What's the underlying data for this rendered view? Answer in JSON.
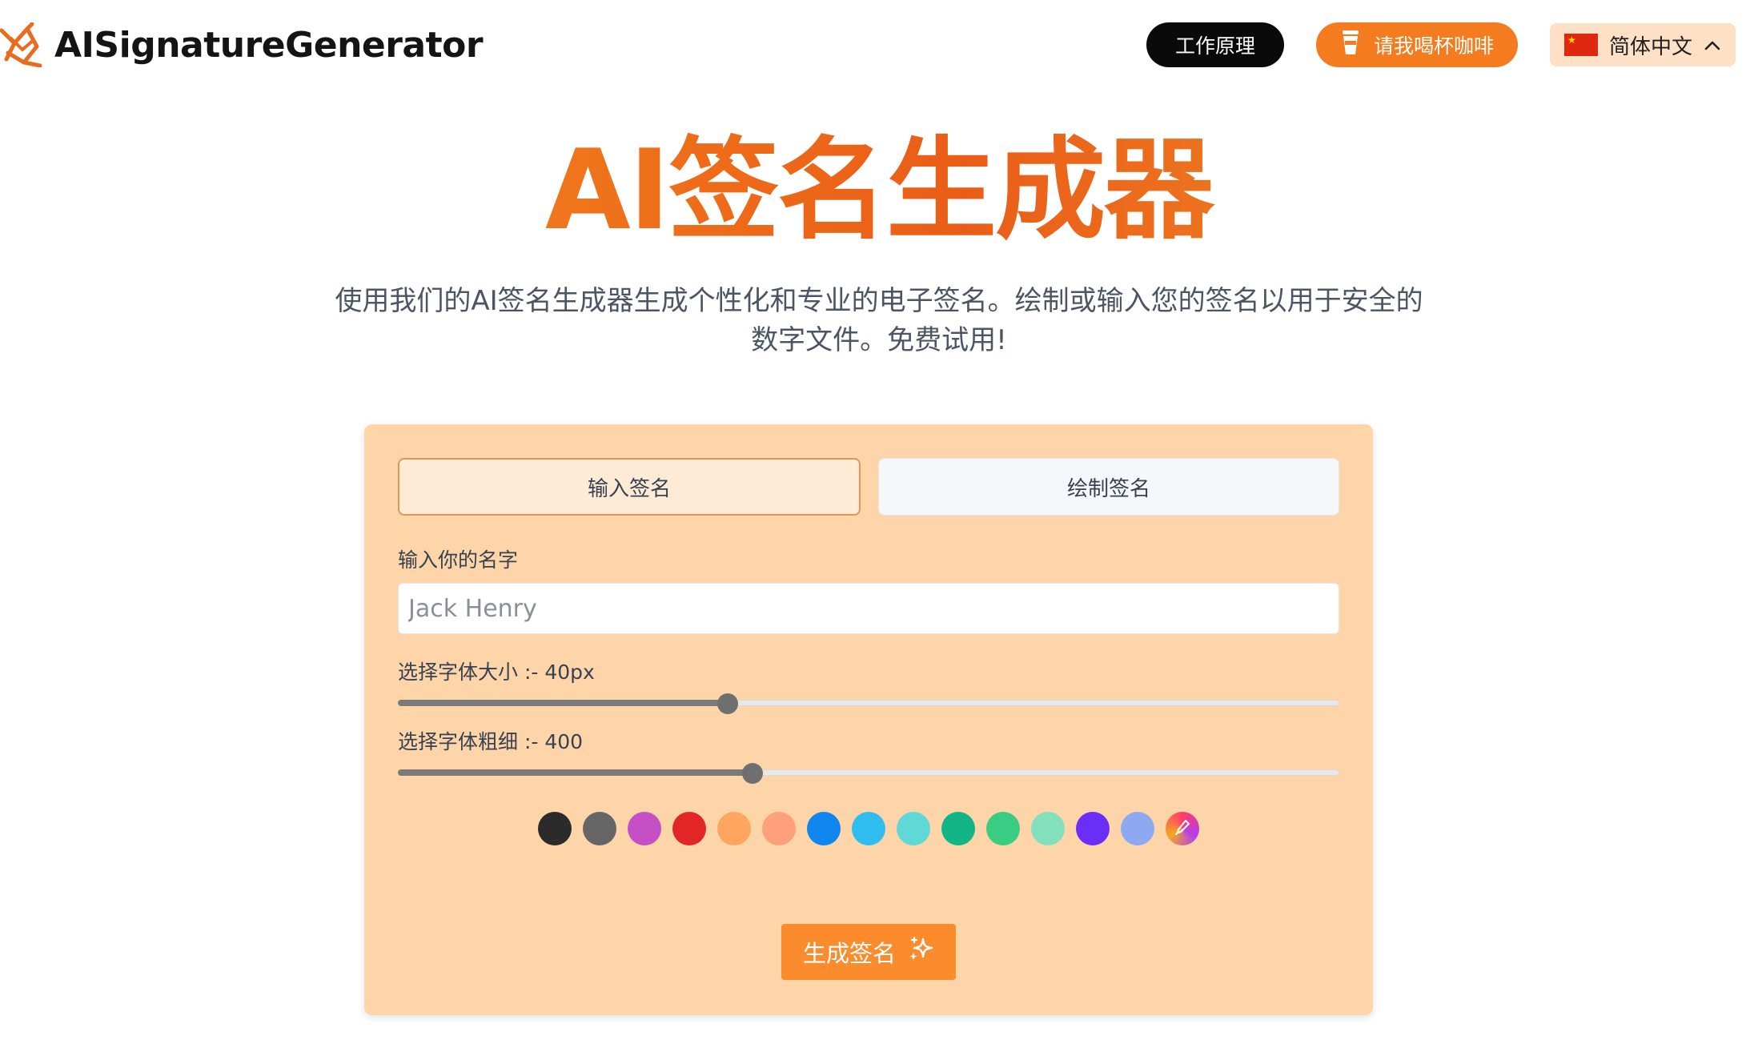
{
  "header": {
    "brand": "AISignatureGenerator",
    "how_it_works": "工作原理",
    "coffee": "请我喝杯咖啡",
    "language": "简体中文"
  },
  "hero": {
    "title": "AI签名生成器",
    "subtitle": "使用我们的AI签名生成器生成个性化和专业的电子签名。绘制或输入您的签名以用于安全的数字文件。免费试用!"
  },
  "card": {
    "tabs": [
      {
        "label": "输入签名",
        "active": true
      },
      {
        "label": "绘制签名",
        "active": false
      }
    ],
    "name_label": "输入你的名字",
    "name_placeholder": "Jack Henry",
    "font_size_label": "选择字体大小 :- 40px",
    "font_size_value": 0.35,
    "font_weight_label": "选择字体粗细 :- 400",
    "font_weight_value": 0.377,
    "colors": [
      "#2b2b2b",
      "#666666",
      "#c54fc4",
      "#e22526",
      "#fea55f",
      "#fda07b",
      "#0f86f0",
      "#2fbdf0",
      "#5fd8d6",
      "#11b586",
      "#39cc83",
      "#82e0bd",
      "#6a2ef7",
      "#8fa8f2"
    ],
    "picker_icon": "eyedropper-icon",
    "generate": "生成签名",
    "generate_icon": "sparkles-icon"
  }
}
